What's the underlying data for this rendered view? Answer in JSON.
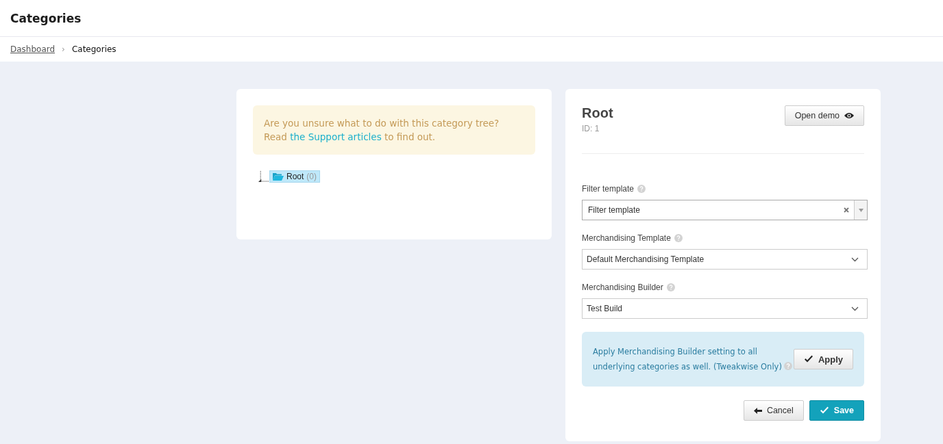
{
  "page_title": "Categories",
  "breadcrumb": [
    {
      "label": "Dashboard",
      "kind": "link"
    },
    {
      "label": "Categories",
      "kind": "current"
    }
  ],
  "breadcrumb_separator": "›",
  "notice": {
    "before": "Are you unsure what to do with this category tree? Read ",
    "link": "the Support articles",
    "after": " to find out."
  },
  "tree": [
    {
      "label": "Root",
      "count": "(0)",
      "selected": true
    }
  ],
  "detail": {
    "title": "Root",
    "id": "ID: 1",
    "open_demo": "Open demo",
    "fields": [
      {
        "label": "Filter template",
        "kind": "combo",
        "value": "Filter template"
      },
      {
        "label": "Merchandising Template",
        "kind": "select",
        "value": "Default Merchandising Template"
      },
      {
        "label": "Merchandising Builder",
        "kind": "select",
        "value": "Test Build"
      }
    ],
    "apply_notice": "Apply Merchandising Builder setting to all underlying categories as well. (Tweakwise Only)",
    "apply_button": "Apply",
    "cancel_button": "Cancel",
    "save_button": "Save"
  }
}
